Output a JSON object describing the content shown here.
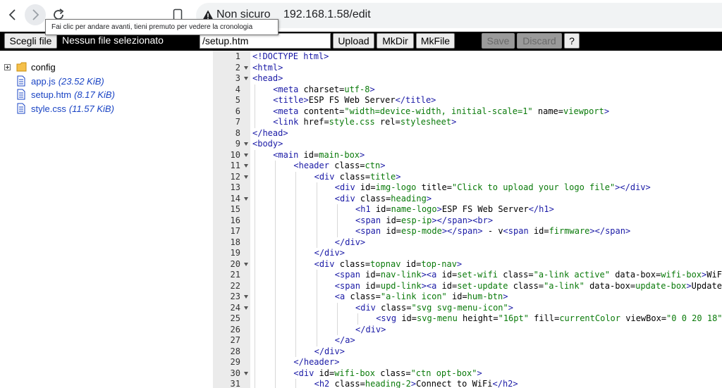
{
  "browser": {
    "security_label": "Non sicuro",
    "url": "192.168.1.58/edit",
    "back_tooltip": "Fai clic per andare avanti, tieni premuto per vedere la cronologia"
  },
  "toolbar": {
    "choose_file_label": "Scegli file",
    "no_file_label": "Nessun file selezionato",
    "path_value": "/setup.htm",
    "upload_label": "Upload",
    "mkdir_label": "MkDir",
    "mkfile_label": "MkFile",
    "save_label": "Save",
    "discard_label": "Discard",
    "help_label": "?"
  },
  "tree": {
    "folder": {
      "name": "config"
    },
    "files": [
      {
        "name": "app.js",
        "size": "(23.52 KiB)"
      },
      {
        "name": "setup.htm",
        "size": "(8.17 KiB)"
      },
      {
        "name": "style.css",
        "size": "(11.57 KiB)"
      }
    ]
  },
  "colors": {
    "tag": "#1a1aa6",
    "attr": "#000000",
    "string": "#0a7a0a",
    "file_link": "#1a44c4",
    "toolbar_bg": "#000000"
  },
  "editor": {
    "lines": [
      {
        "n": "1",
        "fold": false,
        "indent": 0,
        "t": [
          [
            "p",
            "<!DOCTYPE html>"
          ]
        ]
      },
      {
        "n": "2",
        "fold": true,
        "indent": 0,
        "t": [
          [
            "g",
            "<html>"
          ]
        ]
      },
      {
        "n": "3",
        "fold": true,
        "indent": 0,
        "t": [
          [
            "g",
            "<head>"
          ]
        ]
      },
      {
        "n": "4",
        "fold": false,
        "indent": 1,
        "t": [
          [
            "g",
            "<meta "
          ],
          [
            "a",
            "charset="
          ],
          [
            "s",
            "utf-8"
          ],
          [
            "g",
            ">"
          ]
        ]
      },
      {
        "n": "5",
        "fold": false,
        "indent": 1,
        "t": [
          [
            "g",
            "<title>"
          ],
          [
            "x",
            "ESP FS Web Server"
          ],
          [
            "g",
            "</title>"
          ]
        ]
      },
      {
        "n": "6",
        "fold": false,
        "indent": 1,
        "t": [
          [
            "g",
            "<meta "
          ],
          [
            "a",
            "content="
          ],
          [
            "s",
            "\"width=device-width, initial-scale=1\""
          ],
          [
            "a",
            " name="
          ],
          [
            "s",
            "viewport"
          ],
          [
            "g",
            ">"
          ]
        ]
      },
      {
        "n": "7",
        "fold": false,
        "indent": 1,
        "t": [
          [
            "g",
            "<link "
          ],
          [
            "a",
            "href="
          ],
          [
            "s",
            "style.css"
          ],
          [
            "a",
            " rel="
          ],
          [
            "s",
            "stylesheet"
          ],
          [
            "g",
            ">"
          ]
        ]
      },
      {
        "n": "8",
        "fold": false,
        "indent": 0,
        "t": [
          [
            "g",
            "</head>"
          ]
        ]
      },
      {
        "n": "9",
        "fold": true,
        "indent": 0,
        "t": [
          [
            "g",
            "<body>"
          ]
        ]
      },
      {
        "n": "10",
        "fold": true,
        "indent": 1,
        "t": [
          [
            "g",
            "<main "
          ],
          [
            "a",
            "id="
          ],
          [
            "s",
            "main-box"
          ],
          [
            "g",
            ">"
          ]
        ]
      },
      {
        "n": "11",
        "fold": true,
        "indent": 2,
        "t": [
          [
            "g",
            "<header "
          ],
          [
            "a",
            "class="
          ],
          [
            "s",
            "ctn"
          ],
          [
            "g",
            ">"
          ]
        ]
      },
      {
        "n": "12",
        "fold": true,
        "indent": 3,
        "t": [
          [
            "g",
            "<div "
          ],
          [
            "a",
            "class="
          ],
          [
            "s",
            "title"
          ],
          [
            "g",
            ">"
          ]
        ]
      },
      {
        "n": "13",
        "fold": false,
        "indent": 4,
        "t": [
          [
            "g",
            "<div "
          ],
          [
            "a",
            "id="
          ],
          [
            "s",
            "img-logo"
          ],
          [
            "a",
            " title="
          ],
          [
            "s",
            "\"Click to upload your logo file\""
          ],
          [
            "g",
            "></div>"
          ]
        ]
      },
      {
        "n": "14",
        "fold": true,
        "indent": 4,
        "t": [
          [
            "g",
            "<div "
          ],
          [
            "a",
            "class="
          ],
          [
            "s",
            "heading"
          ],
          [
            "g",
            ">"
          ]
        ]
      },
      {
        "n": "15",
        "fold": false,
        "indent": 5,
        "t": [
          [
            "g",
            "<h1 "
          ],
          [
            "a",
            "id="
          ],
          [
            "s",
            "name-logo"
          ],
          [
            "g",
            ">"
          ],
          [
            "x",
            "ESP FS Web Server"
          ],
          [
            "g",
            "</h1>"
          ]
        ]
      },
      {
        "n": "16",
        "fold": false,
        "indent": 5,
        "t": [
          [
            "g",
            "<span "
          ],
          [
            "a",
            "id="
          ],
          [
            "s",
            "esp-ip"
          ],
          [
            "g",
            "></span><br>"
          ]
        ]
      },
      {
        "n": "17",
        "fold": false,
        "indent": 5,
        "t": [
          [
            "g",
            "<span "
          ],
          [
            "a",
            "id="
          ],
          [
            "s",
            "esp-mode"
          ],
          [
            "g",
            "></span>"
          ],
          [
            "x",
            " - v"
          ],
          [
            "g",
            "<span "
          ],
          [
            "a",
            "id="
          ],
          [
            "s",
            "firmware"
          ],
          [
            "g",
            "></span>"
          ]
        ]
      },
      {
        "n": "18",
        "fold": false,
        "indent": 4,
        "t": [
          [
            "g",
            "</div>"
          ]
        ]
      },
      {
        "n": "19",
        "fold": false,
        "indent": 3,
        "t": [
          [
            "g",
            "</div>"
          ]
        ]
      },
      {
        "n": "20",
        "fold": true,
        "indent": 3,
        "t": [
          [
            "g",
            "<div "
          ],
          [
            "a",
            "class="
          ],
          [
            "s",
            "topnav"
          ],
          [
            "a",
            " id="
          ],
          [
            "s",
            "top-nav"
          ],
          [
            "g",
            ">"
          ]
        ]
      },
      {
        "n": "21",
        "fold": false,
        "indent": 4,
        "t": [
          [
            "g",
            "<span "
          ],
          [
            "a",
            "id="
          ],
          [
            "s",
            "nav-link"
          ],
          [
            "g",
            "><a "
          ],
          [
            "a",
            "id="
          ],
          [
            "s",
            "set-wifi"
          ],
          [
            "a",
            " class="
          ],
          [
            "s",
            "\"a-link active\""
          ],
          [
            "a",
            " data-box="
          ],
          [
            "s",
            "wifi-box"
          ],
          [
            "g",
            ">"
          ],
          [
            "x",
            "WiFi"
          ]
        ]
      },
      {
        "n": "22",
        "fold": false,
        "indent": 4,
        "t": [
          [
            "g",
            "<span "
          ],
          [
            "a",
            "id="
          ],
          [
            "s",
            "upd-link"
          ],
          [
            "g",
            "><a "
          ],
          [
            "a",
            "id="
          ],
          [
            "s",
            "set-update"
          ],
          [
            "a",
            " class="
          ],
          [
            "s",
            "\"a-link\""
          ],
          [
            "a",
            " data-box="
          ],
          [
            "s",
            "update-box"
          ],
          [
            "g",
            ">"
          ],
          [
            "x",
            "Update"
          ]
        ]
      },
      {
        "n": "23",
        "fold": true,
        "indent": 4,
        "t": [
          [
            "g",
            "<a "
          ],
          [
            "a",
            "class="
          ],
          [
            "s",
            "\"a-link icon\""
          ],
          [
            "a",
            " id="
          ],
          [
            "s",
            "hum-btn"
          ],
          [
            "g",
            ">"
          ]
        ]
      },
      {
        "n": "24",
        "fold": true,
        "indent": 5,
        "t": [
          [
            "g",
            "<div "
          ],
          [
            "a",
            "class="
          ],
          [
            "s",
            "\"svg svg-menu-icon\""
          ],
          [
            "g",
            ">"
          ]
        ]
      },
      {
        "n": "25",
        "fold": false,
        "indent": 6,
        "t": [
          [
            "g",
            "<svg "
          ],
          [
            "a",
            "id="
          ],
          [
            "s",
            "svg-menu"
          ],
          [
            "a",
            " height="
          ],
          [
            "s",
            "\"16pt\""
          ],
          [
            "a",
            " fill="
          ],
          [
            "s",
            "currentColor"
          ],
          [
            "a",
            " viewBox="
          ],
          [
            "s",
            "\"0 0 20 18\""
          ]
        ]
      },
      {
        "n": "26",
        "fold": false,
        "indent": 5,
        "t": [
          [
            "g",
            "</div>"
          ]
        ]
      },
      {
        "n": "27",
        "fold": false,
        "indent": 4,
        "t": [
          [
            "g",
            "</a>"
          ]
        ]
      },
      {
        "n": "28",
        "fold": false,
        "indent": 3,
        "t": [
          [
            "g",
            "</div>"
          ]
        ]
      },
      {
        "n": "29",
        "fold": false,
        "indent": 2,
        "t": [
          [
            "g",
            "</header>"
          ]
        ]
      },
      {
        "n": "30",
        "fold": true,
        "indent": 2,
        "t": [
          [
            "g",
            "<div "
          ],
          [
            "a",
            "id="
          ],
          [
            "s",
            "wifi-box"
          ],
          [
            "a",
            " class="
          ],
          [
            "s",
            "\"ctn opt-box\""
          ],
          [
            "g",
            ">"
          ]
        ]
      },
      {
        "n": "31",
        "fold": false,
        "indent": 3,
        "t": [
          [
            "g",
            "<h2 "
          ],
          [
            "a",
            "class="
          ],
          [
            "s",
            "heading-2"
          ],
          [
            "g",
            ">"
          ],
          [
            "x",
            "Connect to WiFi"
          ],
          [
            "g",
            "</h2>"
          ]
        ]
      }
    ]
  }
}
